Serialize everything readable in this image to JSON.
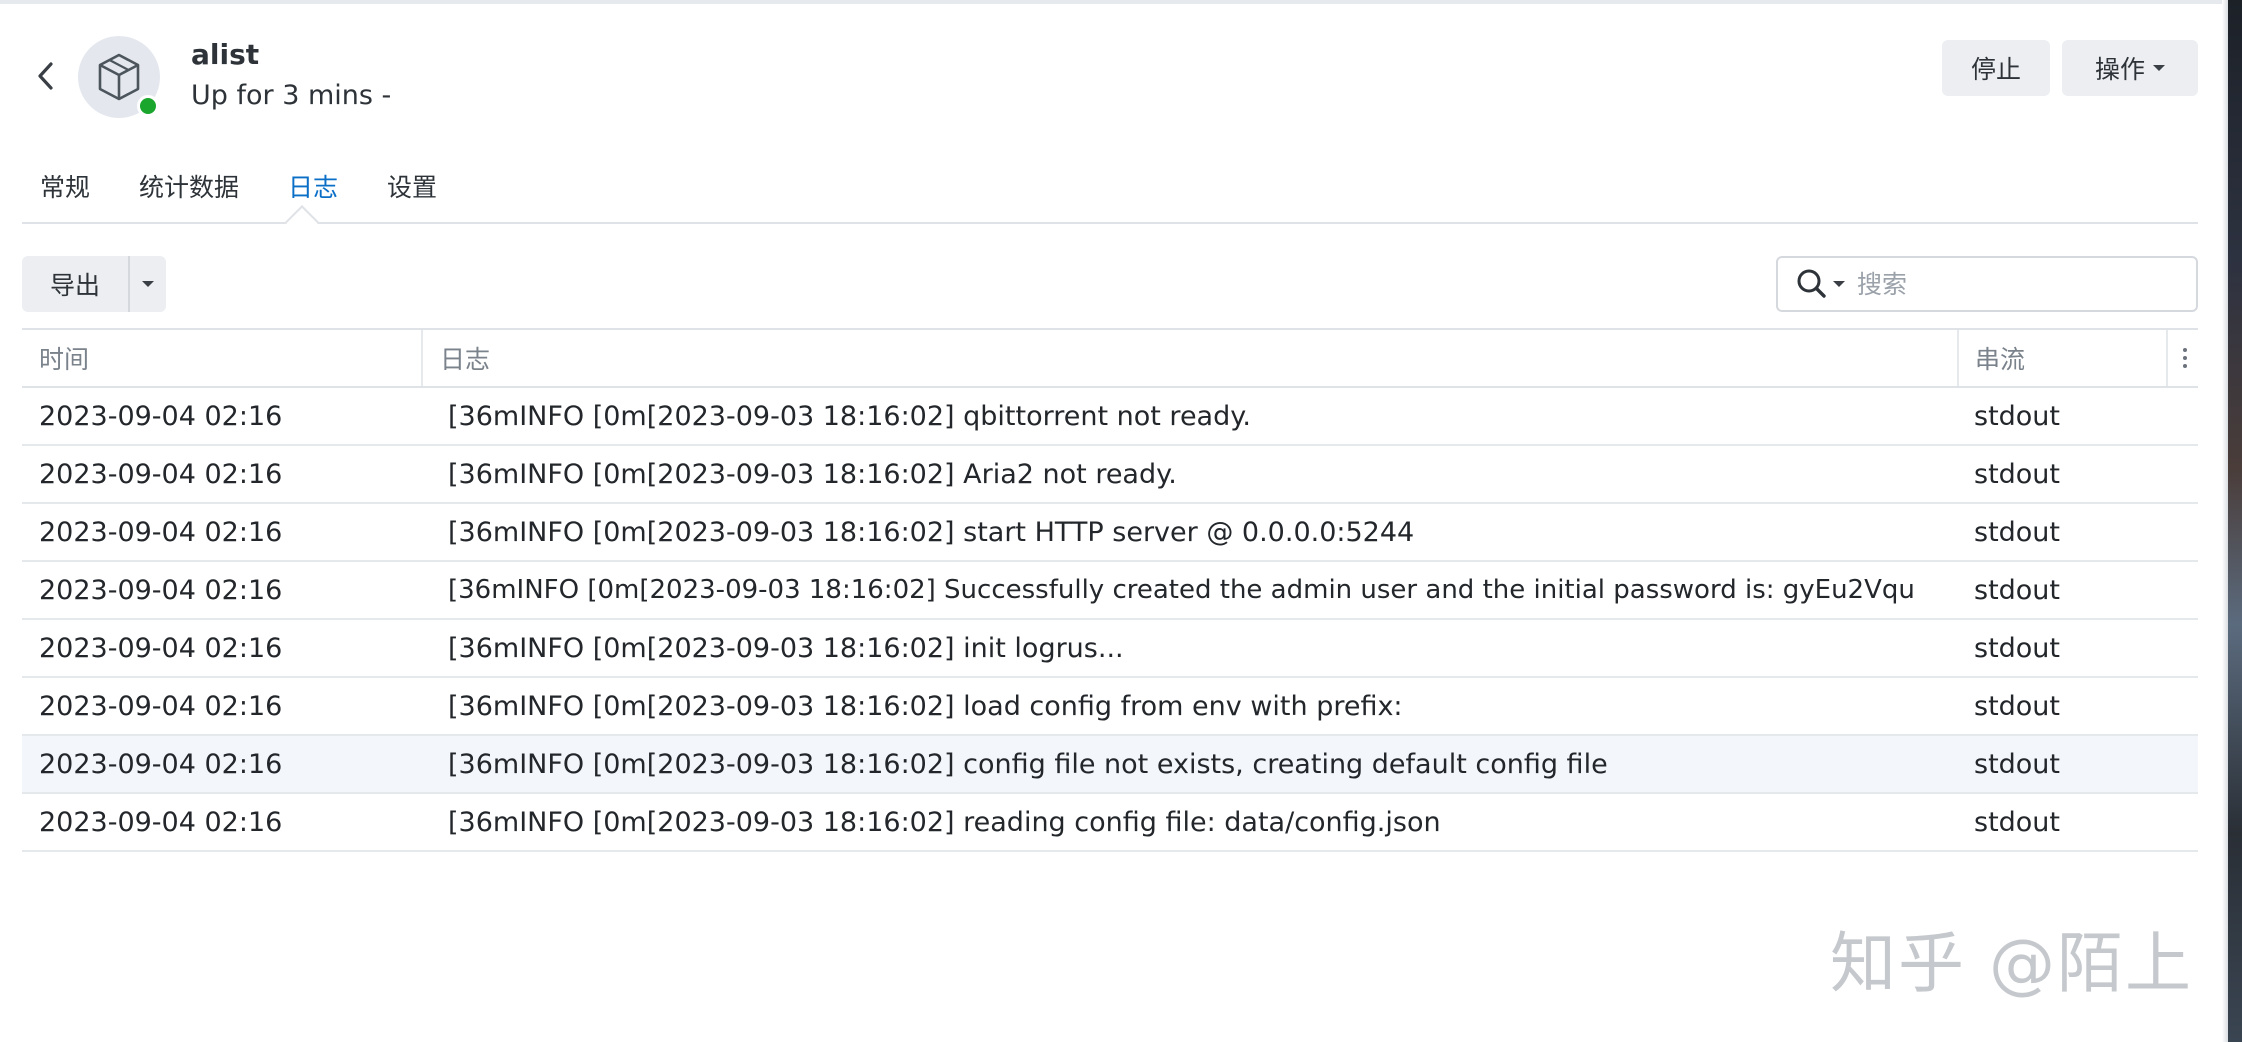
{
  "app": {
    "name": "alist",
    "status": "Up for 3 mins -",
    "status_color": "#1aa52c"
  },
  "header": {
    "stop_label": "停止",
    "actions_label": "操作"
  },
  "tabs": [
    {
      "label": "常规",
      "active": false
    },
    {
      "label": "统计数据",
      "active": false
    },
    {
      "label": "日志",
      "active": true
    },
    {
      "label": "设置",
      "active": false
    }
  ],
  "toolbar": {
    "export_label": "导出",
    "search_placeholder": "搜索"
  },
  "table": {
    "columns": [
      "时间",
      "日志",
      "串流"
    ],
    "rows": [
      {
        "time": "2023-09-04 02:16",
        "log": "[36mINFO [0m[2023-09-03 18:16:02] qbittorrent not ready.",
        "stream": "stdout"
      },
      {
        "time": "2023-09-04 02:16",
        "log": "[36mINFO [0m[2023-09-03 18:16:02] Aria2 not ready.",
        "stream": "stdout"
      },
      {
        "time": "2023-09-04 02:16",
        "log": "[36mINFO [0m[2023-09-03 18:16:02] start HTTP server @ 0.0.0.0:5244",
        "stream": "stdout"
      },
      {
        "time": "2023-09-04 02:16",
        "log": "[36mINFO [0m[2023-09-03 18:16:02] Successfully created the admin user and the initial password is: gyEu2Vqu",
        "stream": "stdout"
      },
      {
        "time": "2023-09-04 02:16",
        "log": "[36mINFO [0m[2023-09-03 18:16:02] init logrus...",
        "stream": "stdout"
      },
      {
        "time": "2023-09-04 02:16",
        "log": "[36mINFO [0m[2023-09-03 18:16:02] load config from env with prefix:",
        "stream": "stdout"
      },
      {
        "time": "2023-09-04 02:16",
        "log": "[36mINFO [0m[2023-09-03 18:16:02] config file not exists, creating default config file",
        "stream": "stdout"
      },
      {
        "time": "2023-09-04 02:16",
        "log": "[36mINFO [0m[2023-09-03 18:16:02] reading config file: data/config.json",
        "stream": "stdout"
      }
    ]
  },
  "watermark": "知乎 @陌上",
  "colors": {
    "accent": "#0b6fc7",
    "running": "#1aa52c"
  },
  "icons": {
    "back": "chevron-left-icon",
    "app": "package-box-icon",
    "search": "search-icon",
    "more": "vertical-ellipsis-icon"
  }
}
